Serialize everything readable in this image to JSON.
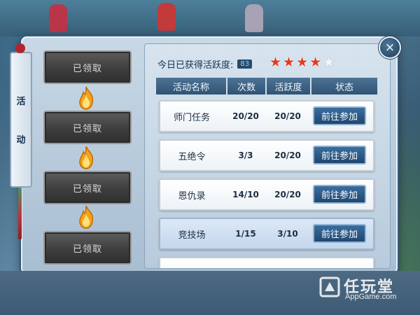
{
  "side_tab": {
    "char1": "活",
    "char2": "动"
  },
  "left_slots": [
    {
      "label": "已领取"
    },
    {
      "label": "已领取"
    },
    {
      "label": "已领取"
    },
    {
      "label": "已领取"
    }
  ],
  "header": {
    "label": "今日已获得活跃度:",
    "score": "83",
    "stars_filled": 4,
    "stars_total": 5
  },
  "table": {
    "columns": [
      "活动名称",
      "次数",
      "活跃度",
      "状态"
    ],
    "rows": [
      {
        "name": "师门任务",
        "count": "20/20",
        "activity": "20/20",
        "action": "前往参加"
      },
      {
        "name": "五绝令",
        "count": "3/3",
        "activity": "20/20",
        "action": "前往参加"
      },
      {
        "name": "恩仇录",
        "count": "14/10",
        "activity": "20/20",
        "action": "前往参加"
      },
      {
        "name": "竞技场",
        "count": "1/15",
        "activity": "3/10",
        "action": "前往参加"
      }
    ]
  },
  "close_icon": "×",
  "watermark": {
    "title": "任玩堂",
    "sub": "AppGame.com"
  },
  "colors": {
    "star_on": "#e13b24",
    "button_blue": "#1e4770",
    "claimed_gray": "#3e3e3e"
  }
}
